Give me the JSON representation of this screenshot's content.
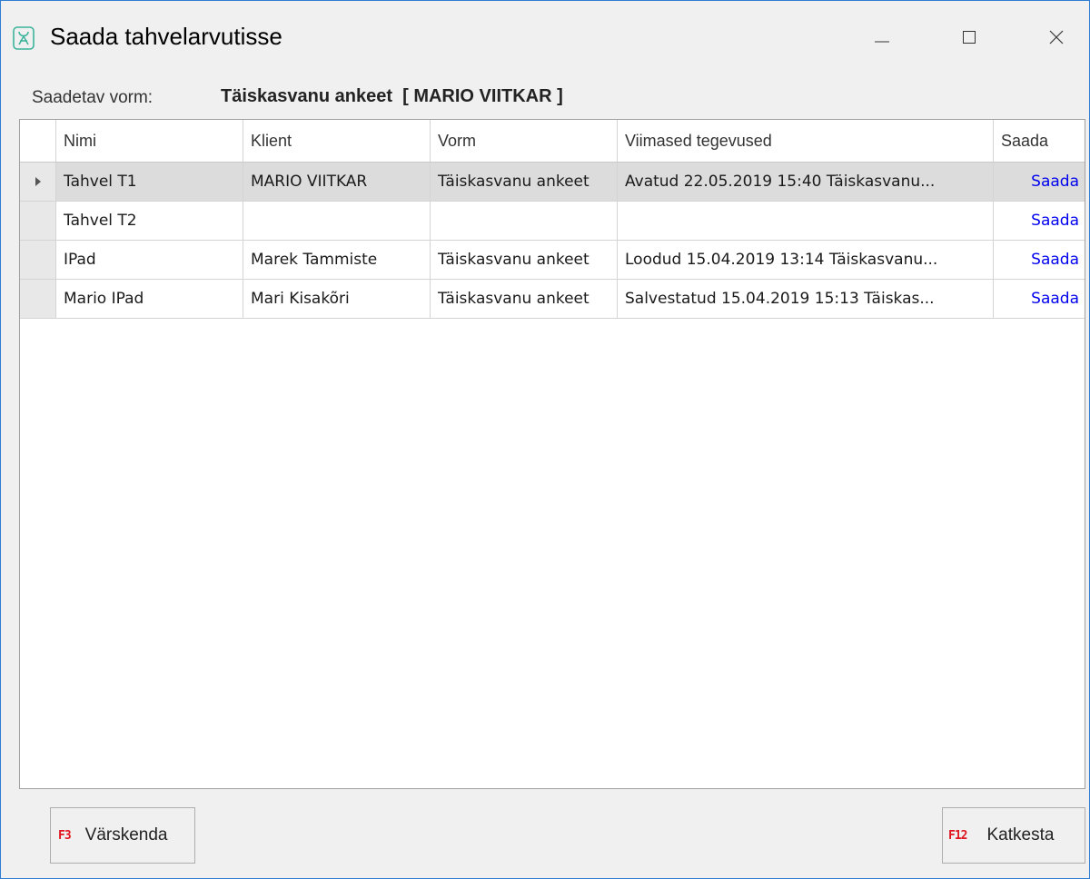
{
  "window": {
    "title": "Saada tahvelarvutisse"
  },
  "form": {
    "label": "Saadetav vorm:",
    "value": "Täiskasvanu ankeet  [ MARIO VIITKAR ]"
  },
  "grid": {
    "columns": [
      "Nimi",
      "Klient",
      "Vorm",
      "Viimased tegevused",
      "Saada"
    ],
    "rows": [
      {
        "nimi": "Tahvel T1",
        "klient": "MARIO VIITKAR",
        "vorm": "Täiskasvanu ankeet",
        "viimased": "Avatud 22.05.2019 15:40 Täiskasvanu...",
        "saada": "Saada"
      },
      {
        "nimi": "Tahvel T2",
        "klient": "",
        "vorm": "",
        "viimased": "",
        "saada": "Saada"
      },
      {
        "nimi": "IPad",
        "klient": "Marek Tammiste",
        "vorm": "Täiskasvanu ankeet",
        "viimased": "Loodud 15.04.2019 13:14 Täiskasvanu...",
        "saada": "Saada"
      },
      {
        "nimi": "Mario IPad",
        "klient": "Mari Kisakõri",
        "vorm": "Täiskasvanu ankeet",
        "viimased": "Salvestatud 15.04.2019 15:13 Täiskas...",
        "saada": "Saada"
      }
    ]
  },
  "buttons": {
    "refresh": {
      "key": "F3",
      "label": "Värskenda"
    },
    "cancel": {
      "key": "F12",
      "label": "Katkesta"
    }
  },
  "colors": {
    "accent": "#2d7dd2",
    "link": "#0000ee",
    "fkey": "#e0141e",
    "app_icon": "#3bb39a"
  }
}
